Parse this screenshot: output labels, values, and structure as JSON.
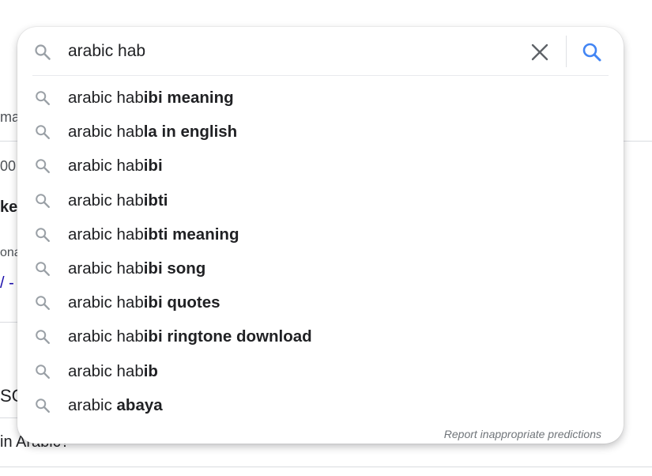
{
  "background": {
    "fragments": [
      "ma",
      "00",
      "ke",
      "ona",
      "/ -",
      "SC",
      "in Arabic?"
    ]
  },
  "search": {
    "query": "arabic hab",
    "icons": {
      "lead": "search-icon",
      "clear": "close-icon",
      "submit": "search-icon"
    },
    "accent_color": "#4285f4"
  },
  "suggestions": [
    {
      "prefix": "arabic hab",
      "completion": "ibi meaning"
    },
    {
      "prefix": "arabic hab",
      "completion": "la in english"
    },
    {
      "prefix": "arabic hab",
      "completion": "ibi"
    },
    {
      "prefix": "arabic hab",
      "completion": "ibti"
    },
    {
      "prefix": "arabic hab",
      "completion": "ibti meaning"
    },
    {
      "prefix": "arabic hab",
      "completion": "ibi song"
    },
    {
      "prefix": "arabic hab",
      "completion": "ibi quotes"
    },
    {
      "prefix": "arabic hab",
      "completion": "ibi ringtone download"
    },
    {
      "prefix": "arabic hab",
      "completion": "ib"
    },
    {
      "prefix": "arabic ",
      "completion": "abaya"
    }
  ],
  "footer": {
    "report_label": "Report inappropriate predictions"
  }
}
